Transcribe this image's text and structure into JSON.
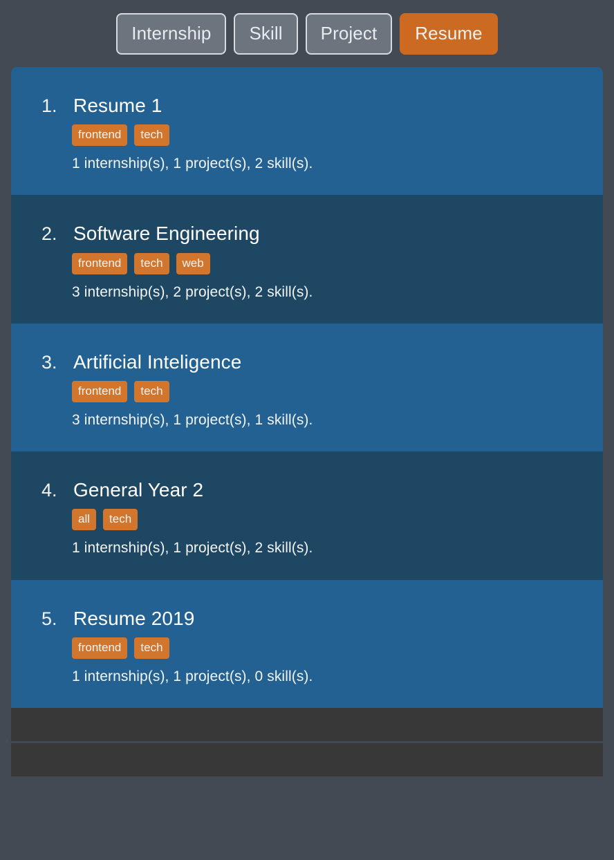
{
  "nav": {
    "items": [
      {
        "label": "Internship",
        "active": false
      },
      {
        "label": "Skill",
        "active": false
      },
      {
        "label": "Project",
        "active": false
      },
      {
        "label": "Resume",
        "active": true
      }
    ]
  },
  "colors": {
    "page_background": "#434a54",
    "nav_button": "#6c757d",
    "nav_button_border": "#d7dbdf",
    "nav_button_active": "#cd6a22",
    "row_odd": "#236192",
    "row_even": "#1d4763",
    "badge": "#d2762e",
    "footer_band": "#383838",
    "text": "#ffffff"
  },
  "list": {
    "items": [
      {
        "index": "1.",
        "title": "Resume 1",
        "tags": [
          "frontend",
          "tech"
        ],
        "meta": "1 internship(s), 1 project(s), 2 skill(s)."
      },
      {
        "index": "2.",
        "title": "Software Engineering",
        "tags": [
          "frontend",
          "tech",
          "web"
        ],
        "meta": "3 internship(s), 2 project(s), 2 skill(s)."
      },
      {
        "index": "3.",
        "title": "Artificial Inteligence",
        "tags": [
          "frontend",
          "tech"
        ],
        "meta": "3 internship(s), 1 project(s), 1 skill(s)."
      },
      {
        "index": "4.",
        "title": "General Year 2",
        "tags": [
          "all",
          "tech"
        ],
        "meta": "1 internship(s), 1 project(s), 2 skill(s)."
      },
      {
        "index": "5.",
        "title": "Resume 2019",
        "tags": [
          "frontend",
          "tech"
        ],
        "meta": "1 internship(s), 1 project(s), 0 skill(s)."
      }
    ]
  },
  "footer": {
    "chevron_glyph": "›"
  }
}
